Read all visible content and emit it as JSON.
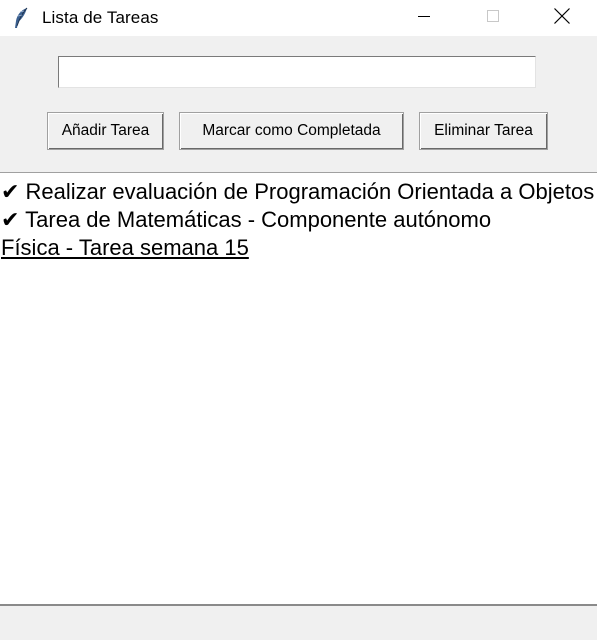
{
  "window": {
    "title": "Lista de Tareas",
    "controls": {
      "minimize_icon": "minimize-icon",
      "maximize_icon": "maximize-icon",
      "close_icon": "close-icon"
    }
  },
  "entry": {
    "value": "",
    "placeholder": ""
  },
  "buttons": {
    "add_label": "Añadir Tarea",
    "complete_label": "Marcar como Completada",
    "delete_label": "Eliminar Tarea"
  },
  "tasks": [
    {
      "text": "✔ Realizar evaluación de Programación Orientada a Objetos",
      "completed": true,
      "active": false
    },
    {
      "text": "✔ Tarea de Matemáticas - Componente autónomo",
      "completed": true,
      "active": false
    },
    {
      "text": "Física - Tarea semana 15",
      "completed": false,
      "active": true
    }
  ]
}
